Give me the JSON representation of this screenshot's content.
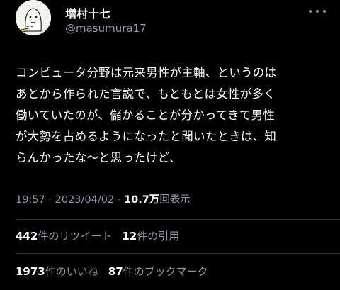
{
  "author": {
    "display_name": "増村十七",
    "handle": "@masumura17"
  },
  "tweet": {
    "lines": [
      "コンピュータ分野は元来男性が主軸、というのは",
      "あとから作られた言説で、もともとは女性が多く",
      "働いていたのが、儲かることが分かってきて男性",
      "が大勢を占めるようになったと聞いたときは、知",
      "らんかったな〜と思ったけど、"
    ]
  },
  "meta": {
    "time": "19:57",
    "separator1": " · ",
    "date": "2023/04/02",
    "separator2": " · ",
    "views_count": "10.7万",
    "views_label": "回表示"
  },
  "stats": {
    "retweets_count": "442",
    "retweets_label": "件のリツイート",
    "quotes_count": "12",
    "quotes_label": "件の引用",
    "likes_count": "1973",
    "likes_label": "件のいいね",
    "bookmarks_count": "87",
    "bookmarks_label": "件のブックマーク"
  },
  "colors": {
    "background": "#000000",
    "text_primary": "#ffffff",
    "text_secondary": "#8b98a5",
    "divider": "#2f3336"
  },
  "icons": {
    "more": "more-horizontal-icon",
    "avatar": "ghost-character-avatar"
  }
}
